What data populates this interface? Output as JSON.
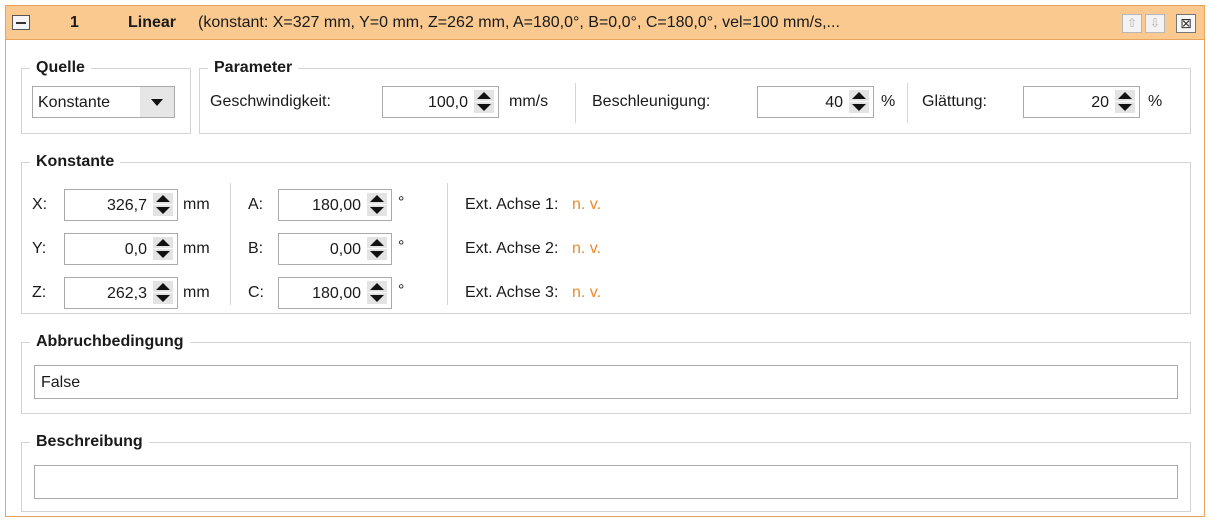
{
  "titlebar": {
    "number": "1",
    "type": "Linear",
    "summary": "(konstant: X=327 mm, Y=0 mm, Z=262 mm, A=180,0°, B=0,0°, C=180,0°, vel=100 mm/s,...",
    "up_icon": "arrow-up-icon",
    "down_icon": "arrow-down-icon",
    "close_icon": "close-icon",
    "close_glyph": "⊠",
    "up_glyph": "⇧",
    "down_glyph": "⇩"
  },
  "quelle": {
    "legend": "Quelle",
    "value": "Konstante"
  },
  "parameter": {
    "legend": "Parameter",
    "speed_label": "Geschwindigkeit:",
    "speed_value": "100,0",
    "speed_unit": "mm/s",
    "accel_label": "Beschleunigung:",
    "accel_value": "40",
    "accel_unit": "%",
    "smooth_label": "Glättung:",
    "smooth_value": "20",
    "smooth_unit": "%"
  },
  "konstante": {
    "legend": "Konstante",
    "x_label": "X:",
    "x_value": "326,7",
    "x_unit": "mm",
    "y_label": "Y:",
    "y_value": "0,0",
    "y_unit": "mm",
    "z_label": "Z:",
    "z_value": "262,3",
    "z_unit": "mm",
    "a_label": "A:",
    "a_value": "180,00",
    "a_unit": "°",
    "b_label": "B:",
    "b_value": "0,00",
    "b_unit": "°",
    "c_label": "C:",
    "c_value": "180,00",
    "c_unit": "°",
    "ext1_label": "Ext. Achse 1:",
    "ext1_value": "n. v.",
    "ext2_label": "Ext. Achse 2:",
    "ext2_value": "n. v.",
    "ext3_label": "Ext. Achse 3:",
    "ext3_value": "n. v."
  },
  "abbruch": {
    "legend": "Abbruchbedingung",
    "value": "False"
  },
  "beschreibung": {
    "legend": "Beschreibung",
    "value": ""
  },
  "colors": {
    "titlebar_bg": "#f9c98f",
    "accent_border": "#e8a45a",
    "na_text": "#e88a2e"
  }
}
